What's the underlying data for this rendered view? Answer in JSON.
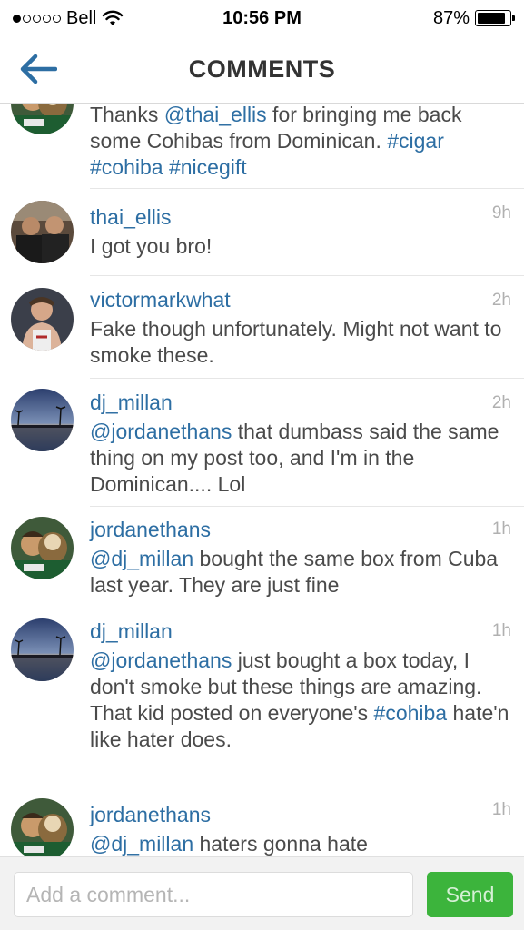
{
  "status_bar": {
    "carrier": "Bell",
    "time": "10:56 PM",
    "battery_percent": "87%",
    "battery_level": 0.87,
    "signal_bars_filled": 1,
    "signal_bars_total": 5
  },
  "header": {
    "title": "COMMENTS",
    "back_icon": "back-arrow-icon",
    "accent_color": "#2d6ea3"
  },
  "comments": [
    {
      "username": "",
      "time": "",
      "text_parts": [
        {
          "t": "Thanks "
        },
        {
          "t": "@thai_ellis",
          "link": true
        },
        {
          "t": " for bringing me back some Cohibas from Dominican. "
        },
        {
          "t": "#cigar",
          "link": true
        },
        {
          "t": " "
        },
        {
          "t": "#cohiba",
          "link": true
        },
        {
          "t": " "
        },
        {
          "t": "#nicegift",
          "link": true
        }
      ]
    },
    {
      "username": "thai_ellis",
      "time": "9h",
      "text_parts": [
        {
          "t": "I got you bro!"
        }
      ]
    },
    {
      "username": "victormarkwhat",
      "time": "2h",
      "text_parts": [
        {
          "t": "Fake though unfortunately. Might not want to smoke these."
        }
      ]
    },
    {
      "username": "dj_millan",
      "time": "2h",
      "text_parts": [
        {
          "t": "@jordanethans",
          "link": true
        },
        {
          "t": " that dumbass said the same thing on my post too, and I'm in the Dominican.... Lol"
        }
      ]
    },
    {
      "username": "jordanethans",
      "time": "1h",
      "text_parts": [
        {
          "t": "@dj_millan",
          "link": true
        },
        {
          "t": " bought the same box from Cuba last year. They are just fine"
        }
      ]
    },
    {
      "username": "dj_millan",
      "time": "1h",
      "text_parts": [
        {
          "t": "@jordanethans",
          "link": true
        },
        {
          "t": " just bought a box today, I don't smoke but these things are amazing. That kid posted on everyone's "
        },
        {
          "t": "#cohiba",
          "link": true
        },
        {
          "t": " hate'n like hater does."
        }
      ]
    },
    {
      "username": "jordanethans",
      "time": "1h",
      "text_parts": [
        {
          "t": "@dj_millan",
          "link": true
        },
        {
          "t": " haters gonna hate"
        }
      ]
    }
  ],
  "composer": {
    "placeholder": "Add a comment...",
    "value": "",
    "send_label": "Send",
    "send_color": "#3cb43c"
  }
}
